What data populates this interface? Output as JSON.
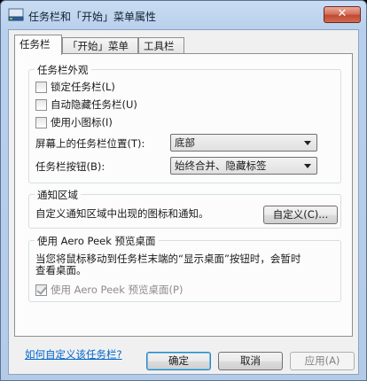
{
  "window": {
    "title": "任务栏和「开始」菜单属性",
    "close_label": "✕"
  },
  "tabs": [
    {
      "label": "任务栏",
      "active": true
    },
    {
      "label": "「开始」菜单",
      "active": false
    },
    {
      "label": "工具栏",
      "active": false
    }
  ],
  "appearance": {
    "title": "任务栏外观",
    "lock_taskbar": {
      "label": "锁定任务栏(L)",
      "checked": false
    },
    "autohide": {
      "label": "自动隐藏任务栏(U)",
      "checked": false
    },
    "small_icons": {
      "label": "使用小图标(I)",
      "checked": false
    },
    "location_label": "屏幕上的任务栏位置(T):",
    "location_value": "底部",
    "buttons_label": "任务栏按钮(B):",
    "buttons_value": "始终合并、隐藏标签"
  },
  "notification": {
    "title": "通知区域",
    "description": "自定义通知区域中出现的图标和通知。",
    "customize_button": "自定义(C)..."
  },
  "peek": {
    "title": "使用 Aero Peek 预览桌面",
    "description_line1": "当您将鼠标移动到任务栏末端的“显示桌面”按钮时，会暂时",
    "description_line2": "查看桌面。",
    "checkbox": {
      "label": "使用 Aero Peek 预览桌面(P)",
      "checked": true
    }
  },
  "help_link": "如何自定义该任务栏?",
  "footer": {
    "ok": "确定",
    "cancel": "取消",
    "apply": "应用(A)"
  }
}
